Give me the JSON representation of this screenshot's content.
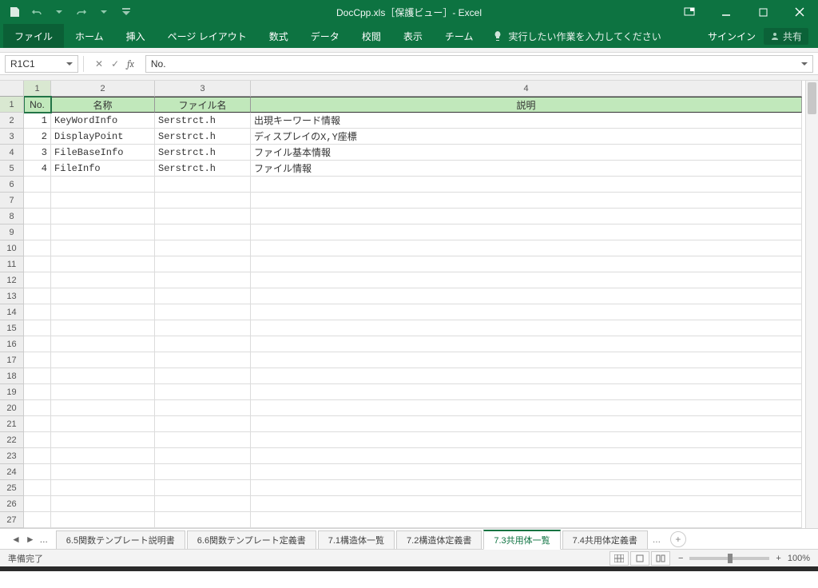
{
  "title": "DocCpp.xls［保護ビュー］- Excel",
  "qat": {
    "save": "save",
    "undo": "undo",
    "redo": "redo"
  },
  "menu": {
    "file": "ファイル",
    "home": "ホーム",
    "insert": "挿入",
    "layout": "ページ レイアウト",
    "formulas": "数式",
    "data": "データ",
    "review": "校閲",
    "view": "表示",
    "team": "チーム",
    "tell": "実行したい作業を入力してください",
    "signin": "サインイン",
    "share": "共有"
  },
  "namebox": "R1C1",
  "formula": "No.",
  "columns": {
    "c1": "1",
    "c2": "2",
    "c3": "3",
    "c4": "4"
  },
  "hdr": {
    "no": "No.",
    "name": "名称",
    "file": "ファイル名",
    "desc": "説明"
  },
  "rows": [
    {
      "no": "1",
      "name": "KeyWordInfo",
      "file": "Serstrct.h",
      "desc": "出現キーワード情報"
    },
    {
      "no": "2",
      "name": "DisplayPoint",
      "file": "Serstrct.h",
      "desc": "ディスプレイのX,Y座標"
    },
    {
      "no": "3",
      "name": "FileBaseInfo",
      "file": "Serstrct.h",
      "desc": "ファイル基本情報"
    },
    {
      "no": "4",
      "name": "FileInfo",
      "file": "Serstrct.h",
      "desc": "ファイル情報"
    }
  ],
  "tabs": [
    {
      "label": "6.5関数テンプレート説明書",
      "active": false
    },
    {
      "label": "6.6関数テンプレート定義書",
      "active": false
    },
    {
      "label": "7.1構造体一覧",
      "active": false
    },
    {
      "label": "7.2構造体定義書",
      "active": false
    },
    {
      "label": "7.3共用体一覧",
      "active": true
    },
    {
      "label": "7.4共用体定義書",
      "active": false
    }
  ],
  "tabmore": "...",
  "status": {
    "ready": "準備完了",
    "zoom": "100%"
  }
}
